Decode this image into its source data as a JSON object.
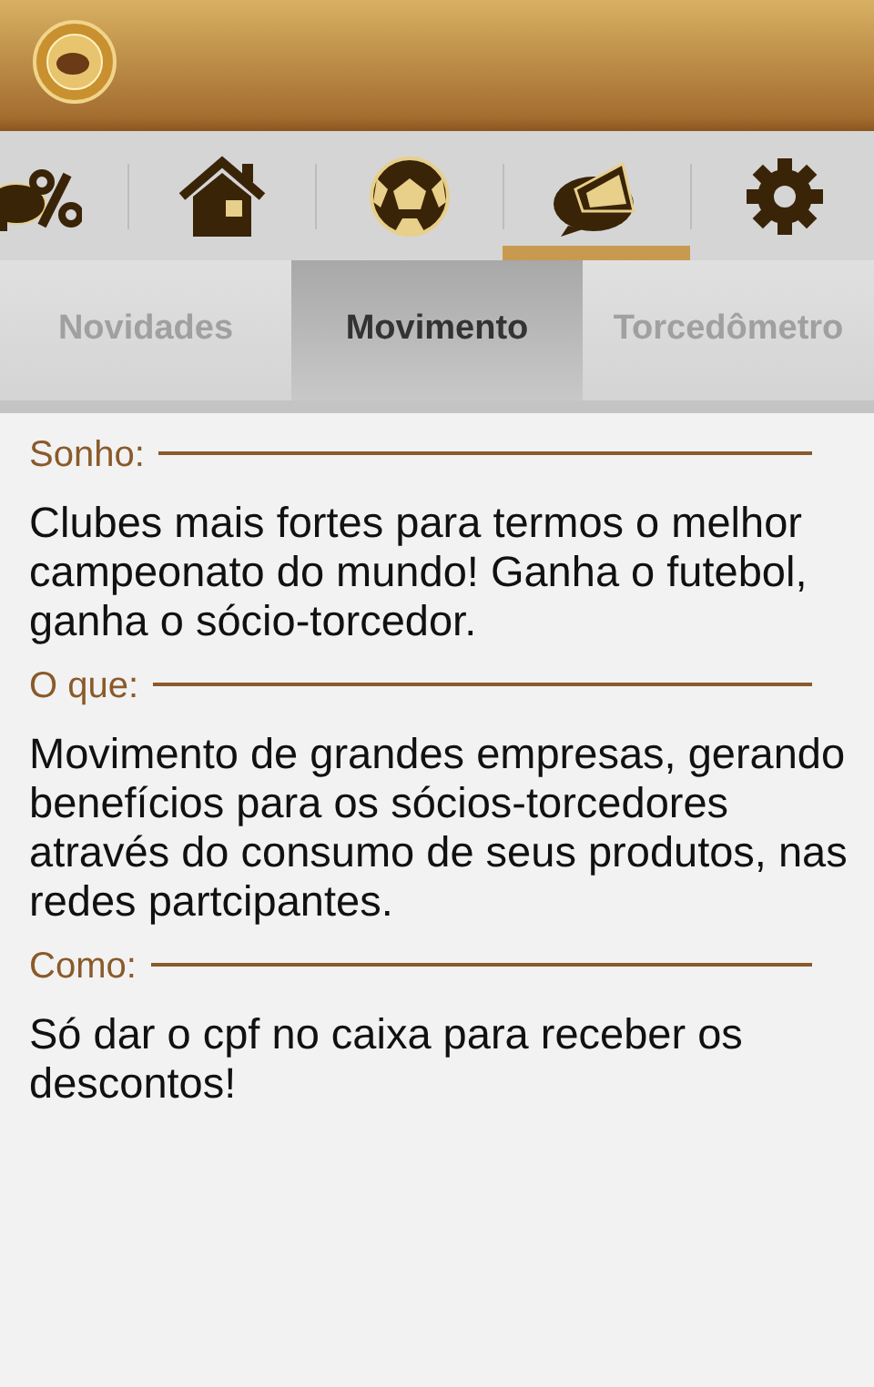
{
  "nav_icons": [
    {
      "kind": "piggy-percent",
      "selected": false
    },
    {
      "kind": "house",
      "selected": false
    },
    {
      "kind": "ball",
      "selected": false
    },
    {
      "kind": "megaphone",
      "selected": true
    },
    {
      "kind": "gear",
      "selected": false
    }
  ],
  "tabs": [
    {
      "label": "Novidades",
      "selected": false
    },
    {
      "label": "Movimento",
      "selected": true
    },
    {
      "label": "Torcedômetro",
      "selected": false
    }
  ],
  "sections": [
    {
      "label": "Sonho:",
      "text": "Clubes mais fortes para termos o melhor campeonato do mundo! Ganha o futebol, ganha o sócio-torcedor."
    },
    {
      "label": "O que:",
      "text": "Movimento de grandes empresas, gerando benefícios para os sócios-torcedores através do consumo de seus produtos, nas redes partcipantes."
    },
    {
      "label": "Como:",
      "text": "Só dar o cpf no caixa para receber os descontos!"
    }
  ]
}
